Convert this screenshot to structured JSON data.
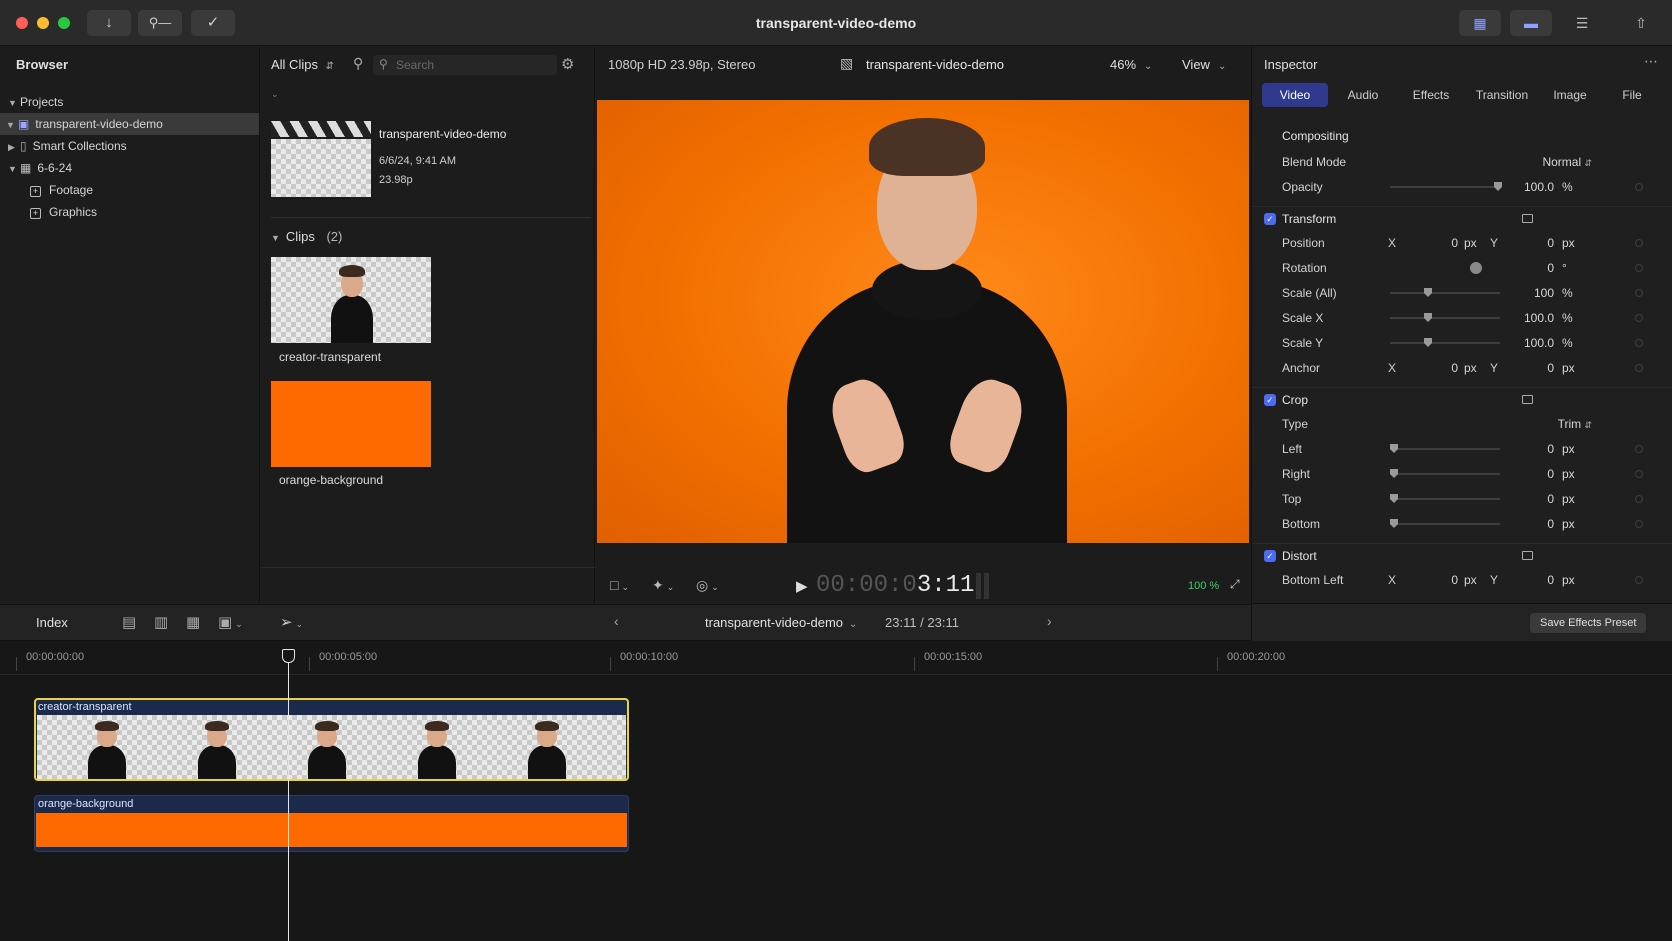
{
  "window": {
    "title": "transparent-video-demo"
  },
  "toolbar": {
    "left_icons": [
      "import-icon",
      "keyword-icon",
      "background-task-icon"
    ],
    "right_icons": [
      "browser-toggle-icon",
      "timeline-toggle-icon",
      "inspector-toggle-icon",
      "share-icon"
    ]
  },
  "browser": {
    "title": "Browser",
    "filter": "All Clips",
    "search_placeholder": "Search",
    "tree": [
      {
        "label": "Projects",
        "level": 0
      },
      {
        "label": "transparent-video-demo",
        "level": 0
      },
      {
        "label": "Smart Collections",
        "level": 0
      },
      {
        "label": "6-6-24",
        "level": 0
      },
      {
        "label": "Footage",
        "level": 1
      },
      {
        "label": "Graphics",
        "level": 1
      }
    ]
  },
  "project_card": {
    "name": "transparent-video-demo",
    "date": "6/6/24, 9:41 AM",
    "rate": "23.98p"
  },
  "clips": {
    "header": "Clips",
    "count": "(2)",
    "items": [
      {
        "name": "creator-transparent"
      },
      {
        "name": "orange-background"
      }
    ]
  },
  "viewer": {
    "format": "1080p HD 23.98p, Stereo",
    "project": "transparent-video-demo",
    "zoom": "46%",
    "view_label": "View",
    "timecode_dim": "00:00:0",
    "timecode_bright": "3:11",
    "playback_zoom": "100 %"
  },
  "inspector": {
    "title": "Inspector",
    "tabs": [
      "Video",
      "Audio",
      "Effects",
      "Transition",
      "Image",
      "File"
    ],
    "compositing": {
      "title": "Compositing",
      "blend_label": "Blend Mode",
      "blend_value": "Normal",
      "opacity_label": "Opacity",
      "opacity_value": "100.0",
      "opacity_unit": "%"
    },
    "transform": {
      "title": "Transform",
      "position_label": "Position",
      "x": "X",
      "y": "Y",
      "pos_x": "0",
      "pos_y": "0",
      "px": "px",
      "rotation_label": "Rotation",
      "rotation_value": "0",
      "deg": "°",
      "scale_all_label": "Scale (All)",
      "scale_all_value": "100",
      "pct": "%",
      "scale_x_label": "Scale X",
      "scale_x_value": "100.0",
      "scale_y_label": "Scale Y",
      "scale_y_value": "100.0",
      "anchor_label": "Anchor",
      "anchor_x": "0",
      "anchor_y": "0"
    },
    "crop": {
      "title": "Crop",
      "type_label": "Type",
      "type_value": "Trim",
      "left_label": "Left",
      "left_value": "0",
      "right_label": "Right",
      "right_value": "0",
      "top_label": "Top",
      "top_value": "0",
      "bottom_label": "Bottom",
      "bottom_value": "0"
    },
    "distort": {
      "title": "Distort",
      "bl_label": "Bottom Left",
      "bl_x": "0",
      "bl_y": "0"
    },
    "save_preset": "Save Effects Preset"
  },
  "timeline_bar": {
    "index": "Index",
    "project": "transparent-video-demo",
    "duration": "23:11 / 23:11"
  },
  "timeline": {
    "ruler": [
      "00:00:00:00",
      "00:00:05:00",
      "00:00:10:00",
      "00:00:15:00",
      "00:00:20:00"
    ],
    "clips": [
      {
        "name": "creator-transparent"
      },
      {
        "name": "orange-background"
      }
    ]
  },
  "colors": {
    "accent": "#4b6bf5",
    "orange": "#ff6a00",
    "selection": "#e8d24a"
  }
}
